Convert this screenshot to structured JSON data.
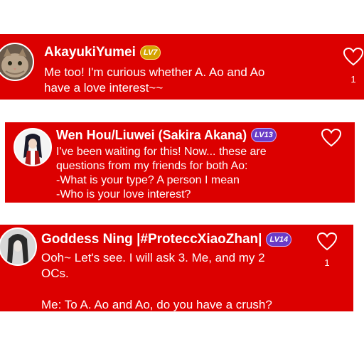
{
  "colors": {
    "card_bg": "#dc0000",
    "text": "#ffffff",
    "badge_gold": "#d4a300",
    "badge_purple": "#6a3cc7"
  },
  "comments": [
    {
      "username": "AkayukiYumei",
      "level": "LV7",
      "message_lines": [
        "Me too! I'm curious whether A. Ao and Ao",
        "have a love interest~~"
      ],
      "like_count": "1",
      "icons": {
        "avatar": "cat-avatar",
        "like": "heart-outline-icon"
      }
    },
    {
      "username": "Wen Hou/Liuwei (Sakira Akana)",
      "level": "LV13",
      "message_lines": [
        "I've been waiting for this! Now... these are",
        "questions from my friends for both Ao:",
        "-What is your type? A person I mean",
        "-Who is your love interest?"
      ],
      "like_count": "",
      "icons": {
        "avatar": "anime-girl-avatar",
        "like": "heart-outline-icon"
      }
    },
    {
      "username": "Goddess Ning |#ProteccXiaoZhan|",
      "level": "LV14",
      "message_lines": [
        "Ooh~ Let's see. I will ask 3. Me, and my 2",
        "OCs.",
        "",
        "Me: To A. Ao and Ao, do you have a crush?"
      ],
      "like_count": "1",
      "icons": {
        "avatar": "dark-hair-avatar",
        "like": "heart-outline-icon"
      }
    }
  ]
}
